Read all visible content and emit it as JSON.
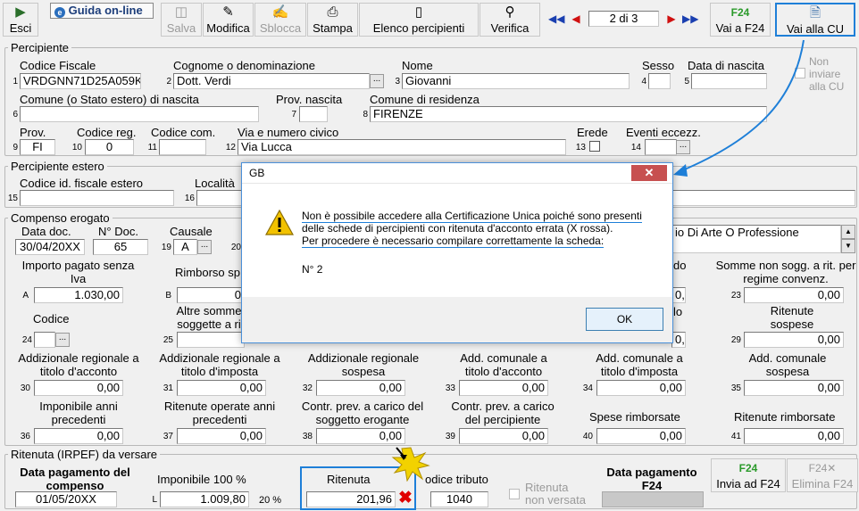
{
  "toolbar": {
    "esci": "Esci",
    "guida": "Guida on-line",
    "salva": "Salva",
    "modifica": "Modifica",
    "sblocca": "Sblocca",
    "stampa": "Stampa",
    "elenco": "Elenco percipienti",
    "verifica": "Verifica",
    "page_indicator": "2 di 3",
    "vai_f24": "Vai a F24",
    "vai_cu": "Vai alla CU"
  },
  "percipiente": {
    "title": "Percipiente",
    "codice_fiscale_label": "Codice Fiscale",
    "codice_fiscale": "VRDGNN71D25A059K",
    "cognome_label": "Cognome o denominazione",
    "cognome": "Dott. Verdi",
    "nome_label": "Nome",
    "nome": "Giovanni",
    "sesso_label": "Sesso",
    "sesso": "",
    "data_nascita_label": "Data di nascita",
    "data_nascita": "",
    "comune_nascita_label": "Comune (o Stato estero) di nascita",
    "comune_nascita": "",
    "prov_nascita_label": "Prov. nascita",
    "prov_nascita": "",
    "comune_residenza_label": "Comune di residenza",
    "comune_residenza": "FIRENZE",
    "prov_label": "Prov.",
    "prov": "FI",
    "codice_reg_label": "Codice reg.",
    "codice_reg": "0",
    "codice_com_label": "Codice com.",
    "codice_com": "",
    "via_label": "Via e numero civico",
    "via": "Via Lucca",
    "erede_label": "Erede",
    "eventi_label": "Eventi eccezz.",
    "eventi": "",
    "non_inviare_label": "Non inviare alla CU"
  },
  "estero": {
    "title": "Percipiente estero",
    "codice_id_label": "Codice id. fiscale estero",
    "codice_id": "",
    "localita_label": "Località",
    "localita": ""
  },
  "compenso": {
    "title": "Compenso erogato",
    "data_doc_label": "Data doc.",
    "data_doc": "30/04/20XX",
    "n_doc_label": "N° Doc.",
    "n_doc": "65",
    "causale_label": "Causale",
    "causale": "A",
    "causale_desc": "io Di Arte O Professione",
    "importo_label": "Importo pagato senza Iva",
    "importo": "1.030,00",
    "rimborso_label": "Rimborso sp",
    "rimborso": "0",
    "do_label": "do",
    "do_val": "0,00",
    "somme_label": "Somme non sogg. a rit. per regime convenz.",
    "somme": "0,00",
    "codice_label": "Codice",
    "codice": "",
    "altre_label": "Altre somme soggette a ri",
    "altre": "",
    "lo_label": "lo",
    "lo_val": "0,00",
    "rit_sospese_label": "Ritenute sospese",
    "rit_sospese": "0,00",
    "add_reg_acc_label": "Addizionale regionale a titolo d'acconto",
    "add_reg_acc": "0,00",
    "add_reg_imp_label": "Addizionale regionale a titolo d'imposta",
    "add_reg_imp": "0,00",
    "add_reg_sosp_label": "Addizionale regionale sospesa",
    "add_reg_sosp": "0,00",
    "add_com_acc_label": "Add. comunale a titolo d'acconto",
    "add_com_acc": "0,00",
    "add_com_imp_label": "Add. comunale a titolo d'imposta",
    "add_com_imp": "0,00",
    "add_com_sosp_label": "Add. comunale sospesa",
    "add_com_sosp": "0,00",
    "imp_prec_label": "Imponibile anni precedenti",
    "imp_prec": "0,00",
    "rit_prec_label": "Ritenute operate anni precedenti",
    "rit_prec": "0,00",
    "contr_erog_label": "Contr. prev. a carico del soggetto erogante",
    "contr_erog": "0,00",
    "contr_perc_label": "Contr. prev. a carico del percipiente",
    "contr_perc": "0,00",
    "spese_label": "Spese rimborsate",
    "spese": "0,00",
    "rit_rimb_label": "Ritenute rimborsate",
    "rit_rimb": "0,00"
  },
  "ritenuta": {
    "title": "Ritenuta (IRPEF) da versare",
    "data_pag_label": "Data pagamento del compenso",
    "data_pag": "01/05/20XX",
    "imponibile_label": "Imponibile 100 %",
    "imponibile": "1.009,80",
    "perc": "20 %",
    "ritenuta_label": "Ritenuta",
    "ritenuta": "201,96",
    "codice_tributo_label": "odice tributo",
    "codice_tributo": "1040",
    "non_versata_label": "Ritenuta non versata",
    "data_f24_label": "Data pagamento F24",
    "invia_f24": "Invia ad F24",
    "elimina_f24": "Elimina F24"
  },
  "numbers": [
    "1",
    "2",
    "3",
    "4",
    "5",
    "6",
    "7",
    "8",
    "9",
    "10",
    "11",
    "12",
    "13",
    "14",
    "15",
    "16",
    "19",
    "20",
    "A",
    "B",
    "23",
    "24",
    "25",
    "29",
    "30",
    "31",
    "32",
    "33",
    "34",
    "35",
    "36",
    "37",
    "38",
    "39",
    "40",
    "41",
    "L"
  ],
  "dialog": {
    "title": "GB",
    "line1": "Non è possibile accedere alla Certificazione Unica poiché sono presenti",
    "line2": "delle schede di percipienti con ritenuta d'acconto errata (X rossa).",
    "line3": "Per procedere è necessario compilare correttamente la scheda:",
    "detail": "N° 2",
    "ok": "OK"
  },
  "colors": {
    "accent": "#1e7fd8",
    "error": "#e00000",
    "warning": "#f2c200"
  }
}
